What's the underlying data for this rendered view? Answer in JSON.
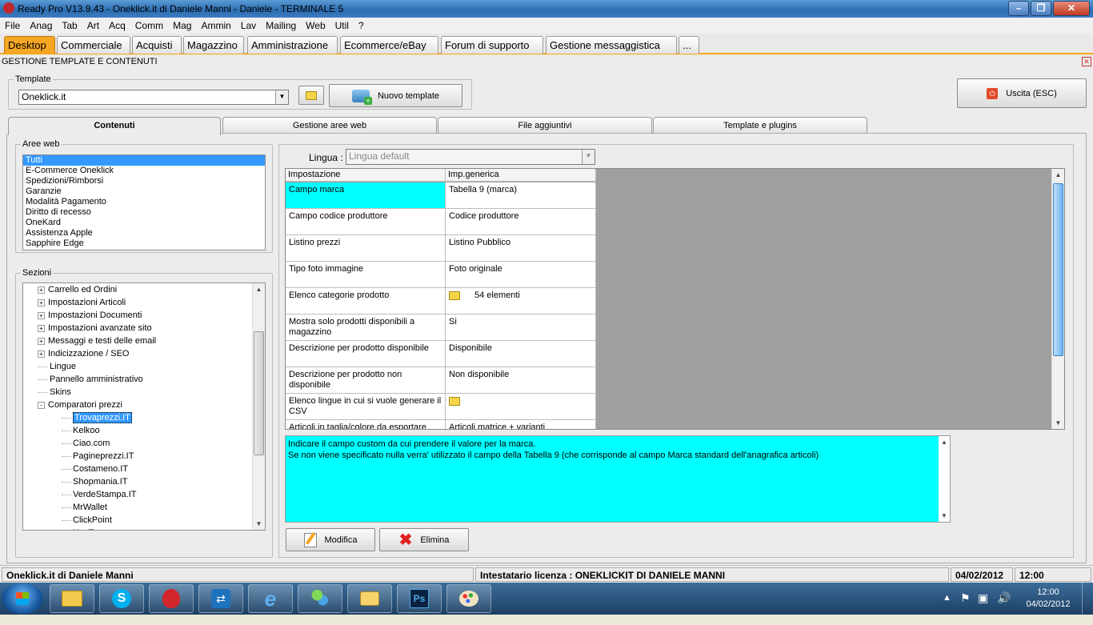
{
  "window": {
    "title": "Ready Pro V13.9.43 - Oneklick.it di Daniele Manni - Daniele - TERMINALE 5"
  },
  "menu": [
    "File",
    "Anag",
    "Tab",
    "Art",
    "Acq",
    "Comm",
    "Mag",
    "Ammin",
    "Lav",
    "Mailing",
    "Web",
    "Util",
    "?"
  ],
  "main_tabs": [
    "Desktop",
    "Commerciale",
    "Acquisti",
    "Magazzino",
    "Amministrazione",
    "Ecommerce/eBay",
    "Forum di supporto",
    "Gestione messaggistica",
    "..."
  ],
  "subtitle": "GESTIONE TEMPLATE E CONTENUTI",
  "template": {
    "group_label": "Template",
    "selected": "Oneklick.it",
    "new_button": "Nuovo template"
  },
  "exit_button": "Uscita (ESC)",
  "content_tabs": [
    "Contenuti",
    "Gestione aree web",
    "File aggiuntivi",
    "Template e plugins"
  ],
  "aree_web": {
    "label": "Aree web",
    "items": [
      "Tutti",
      "E-Commerce Oneklick",
      "Spedizioni/Rimborsi",
      "Garanzie",
      "Modalità Pagamento",
      "Diritto di recesso",
      "OneKard",
      "Assistenza Apple",
      "Sapphire Edge"
    ],
    "selected_index": 0
  },
  "sezioni": {
    "label": "Sezioni",
    "nodes": [
      {
        "text": "Carrello ed Ordini",
        "level": 1,
        "expand": "+"
      },
      {
        "text": "Impostazioni Articoli",
        "level": 1,
        "expand": "+"
      },
      {
        "text": "Impostazioni Documenti",
        "level": 1,
        "expand": "+"
      },
      {
        "text": "Impostazioni avanzate sito",
        "level": 1,
        "expand": "+"
      },
      {
        "text": "Messaggi e testi delle email",
        "level": 1,
        "expand": "+"
      },
      {
        "text": "Indicizzazione / SEO",
        "level": 1,
        "expand": "+"
      },
      {
        "text": "Lingue",
        "level": 1,
        "expand": ""
      },
      {
        "text": "Pannello amministrativo",
        "level": 1,
        "expand": ""
      },
      {
        "text": "Skins",
        "level": 1,
        "expand": ""
      },
      {
        "text": "Comparatori prezzi",
        "level": 1,
        "expand": "-"
      },
      {
        "text": "Trovaprezzi.IT",
        "level": 2,
        "expand": "",
        "selected": true
      },
      {
        "text": "Kelkoo",
        "level": 2,
        "expand": ""
      },
      {
        "text": "Ciao.com",
        "level": 2,
        "expand": ""
      },
      {
        "text": "Pagineprezzi.IT",
        "level": 2,
        "expand": ""
      },
      {
        "text": "Costameno.IT",
        "level": 2,
        "expand": ""
      },
      {
        "text": "Shopmania.IT",
        "level": 2,
        "expand": ""
      },
      {
        "text": "VerdeStampa.IT",
        "level": 2,
        "expand": ""
      },
      {
        "text": "MrWallet",
        "level": 2,
        "expand": ""
      },
      {
        "text": "ClickPoint",
        "level": 2,
        "expand": ""
      },
      {
        "text": "NexTag",
        "level": 2,
        "expand": ""
      }
    ]
  },
  "lingua": {
    "label": "Lingua :",
    "value": "Lingua default"
  },
  "grid": {
    "headers": [
      "Impostazione",
      "Imp.generica"
    ],
    "rows": [
      {
        "name": "Campo marca",
        "value": "Tabella 9 (marca)",
        "highlight": true
      },
      {
        "name": "Campo codice produttore",
        "value": "Codice produttore"
      },
      {
        "name": "Listino prezzi",
        "value": "Listino Pubblico"
      },
      {
        "name": "Tipo foto immagine",
        "value": "Foto originale"
      },
      {
        "name": "Elenco categorie prodotto",
        "value": "54 elementi",
        "icon": true
      },
      {
        "name": "Mostra solo prodotti disponibili a magazzino",
        "value": "Si"
      },
      {
        "name": "Descrizione per prodotto disponibile",
        "value": "Disponibile"
      },
      {
        "name": "Descrizione per prodotto non disponibile",
        "value": "Non disponibile"
      },
      {
        "name": "Elenco lingue in cui si vuole generare il CSV",
        "value": "",
        "icon": true
      },
      {
        "name": "Articoli in taglia/colore da esportare",
        "value": "Articoli matrice + varianti"
      }
    ]
  },
  "description": {
    "line1": "Indicare il campo custom da cui prendere il valore per la marca.",
    "line2": "Se non viene specificato nulla verra' utilizzato il campo della Tabella 9 (che corrisponde al campo Marca standard dell'anagrafica articoli)"
  },
  "actions": {
    "modify": "Modifica",
    "delete": "Elimina"
  },
  "status": {
    "company": "Oneklick.it di Daniele Manni",
    "license": "Intestatario licenza : ONEKLICKIT DI DANIELE MANNI",
    "date": "04/02/2012",
    "time": "12:00"
  },
  "taskbar": {
    "clock_time": "12:00",
    "clock_date": "04/02/2012",
    "apps": [
      "explorer",
      "skype",
      "readypro",
      "teamviewer",
      "ie",
      "messenger",
      "outlook",
      "photoshop",
      "paint"
    ]
  },
  "colors": {
    "accent": "#f5a623",
    "highlight": "#00ffff",
    "selection": "#3399ff"
  }
}
